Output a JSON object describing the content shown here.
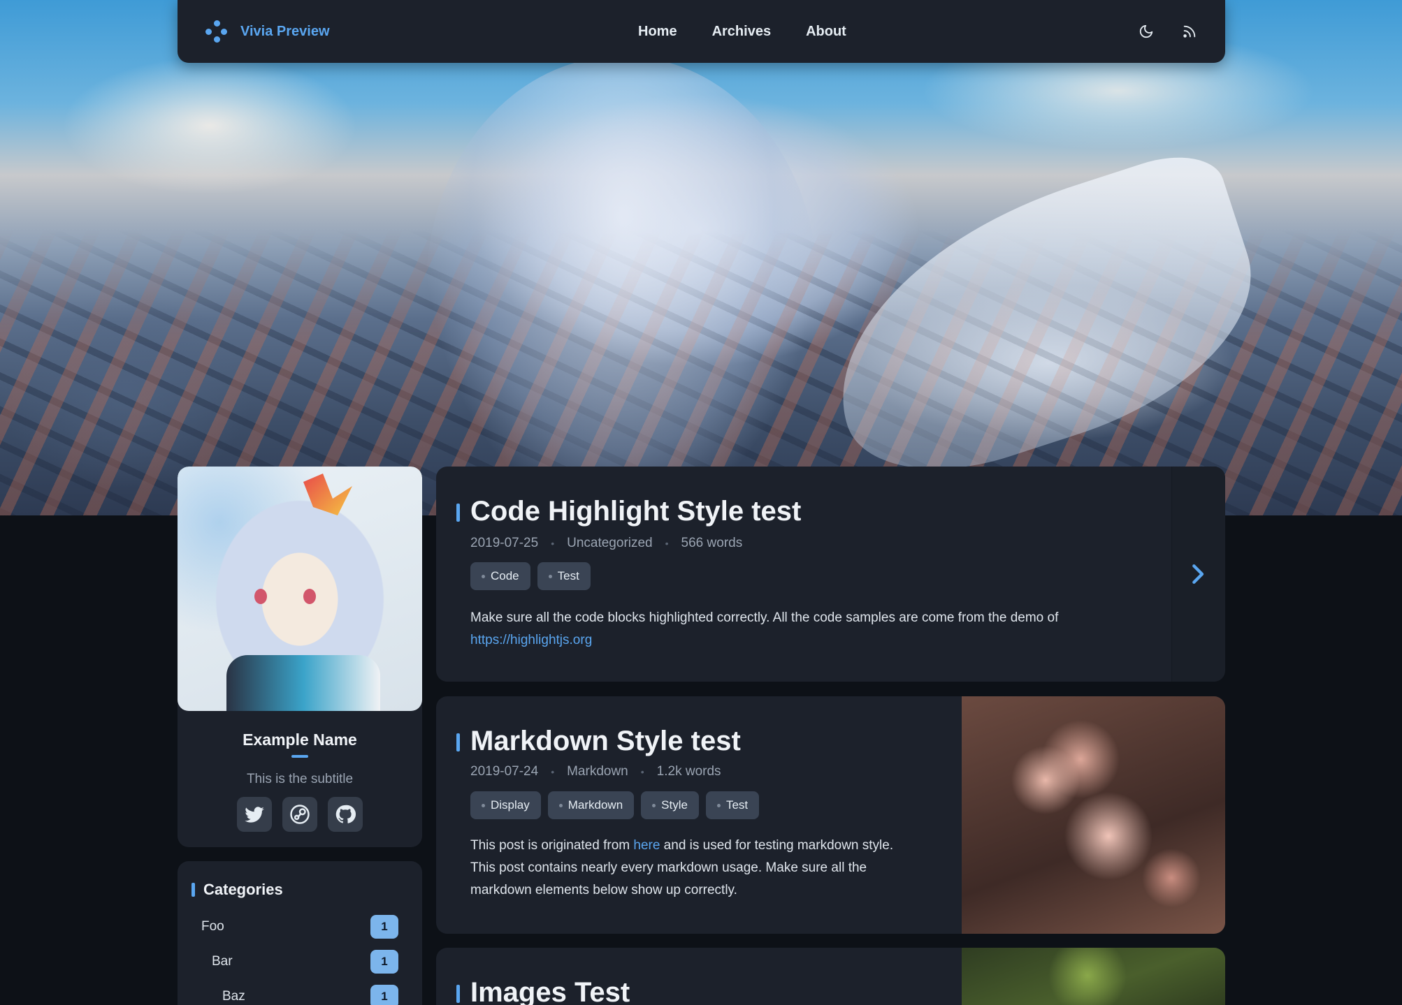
{
  "nav": {
    "brand": "Vivia Preview",
    "links": [
      "Home",
      "Archives",
      "About"
    ]
  },
  "profile": {
    "name": "Example Name",
    "subtitle": "This is the subtitle",
    "socials": [
      "twitter-icon",
      "steam-icon",
      "github-icon"
    ]
  },
  "categories": {
    "title": "Categories",
    "items": [
      {
        "name": "Foo",
        "count": "1"
      },
      {
        "name": "Bar",
        "count": "1"
      },
      {
        "name": "Baz",
        "count": "1"
      }
    ]
  },
  "posts": [
    {
      "title": "Code Highlight Style test",
      "date": "2019-07-25",
      "category": "Uncategorized",
      "words": "566 words",
      "tags": [
        "Code",
        "Test"
      ],
      "excerpt_line1": "Make sure all the code blocks highlighted correctly. All the code samples are come from the demo of",
      "excerpt_link": "https://highlightjs.org"
    },
    {
      "title": "Markdown Style test",
      "date": "2019-07-24",
      "category": "Markdown",
      "words": "1.2k words",
      "tags": [
        "Display",
        "Markdown",
        "Style",
        "Test"
      ],
      "excerpt_pre": "This post is originated from ",
      "excerpt_link": "here",
      "excerpt_post": " and is used for testing markdown style.",
      "excerpt_line2": "This post contains nearly every markdown usage. Make sure all the",
      "excerpt_line3": "markdown elements below show up correctly."
    },
    {
      "title": "Images Test"
    }
  ],
  "colors": {
    "accent": "#5aa6f0",
    "card": "#1c212b",
    "page": "#0d1117",
    "badge": "#7cb5ec",
    "tag": "#3a4454"
  },
  "icons": {
    "theme_toggle": "moon-icon",
    "rss": "rss-icon",
    "next": "chevron-right-icon",
    "logo": "dots-logo-icon"
  }
}
